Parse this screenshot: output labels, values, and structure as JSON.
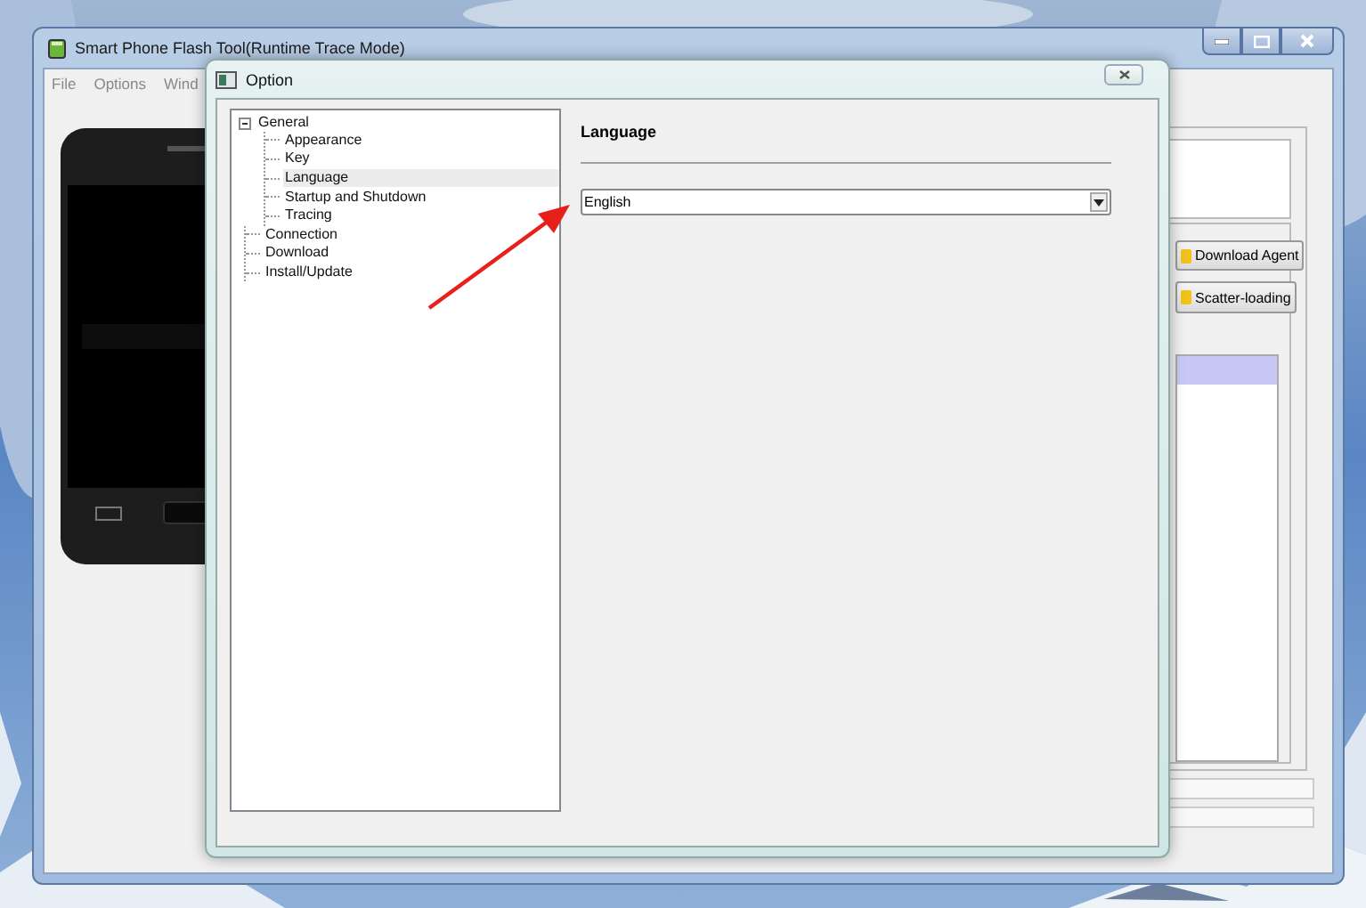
{
  "main_window": {
    "title": "Smart Phone Flash Tool(Runtime Trace Mode)",
    "menu": [
      "File",
      "Options",
      "Wind"
    ],
    "buttons": [
      {
        "label": "Download Agent"
      },
      {
        "label": "Scatter-loading"
      }
    ]
  },
  "dialog": {
    "title": "Option",
    "tree": [
      {
        "label": "General",
        "expanded": true,
        "selected": false,
        "children": [
          {
            "label": "Appearance",
            "selected": false
          },
          {
            "label": "Key",
            "selected": false
          },
          {
            "label": "Language",
            "selected": true
          },
          {
            "label": "Startup and Shutdown",
            "selected": false
          },
          {
            "label": "Tracing",
            "selected": false
          }
        ]
      },
      {
        "label": "Connection",
        "selected": false
      },
      {
        "label": "Download",
        "selected": false
      },
      {
        "label": "Install/Update",
        "selected": false
      }
    ],
    "section_title": "Language",
    "language_select": {
      "value": "English"
    }
  }
}
